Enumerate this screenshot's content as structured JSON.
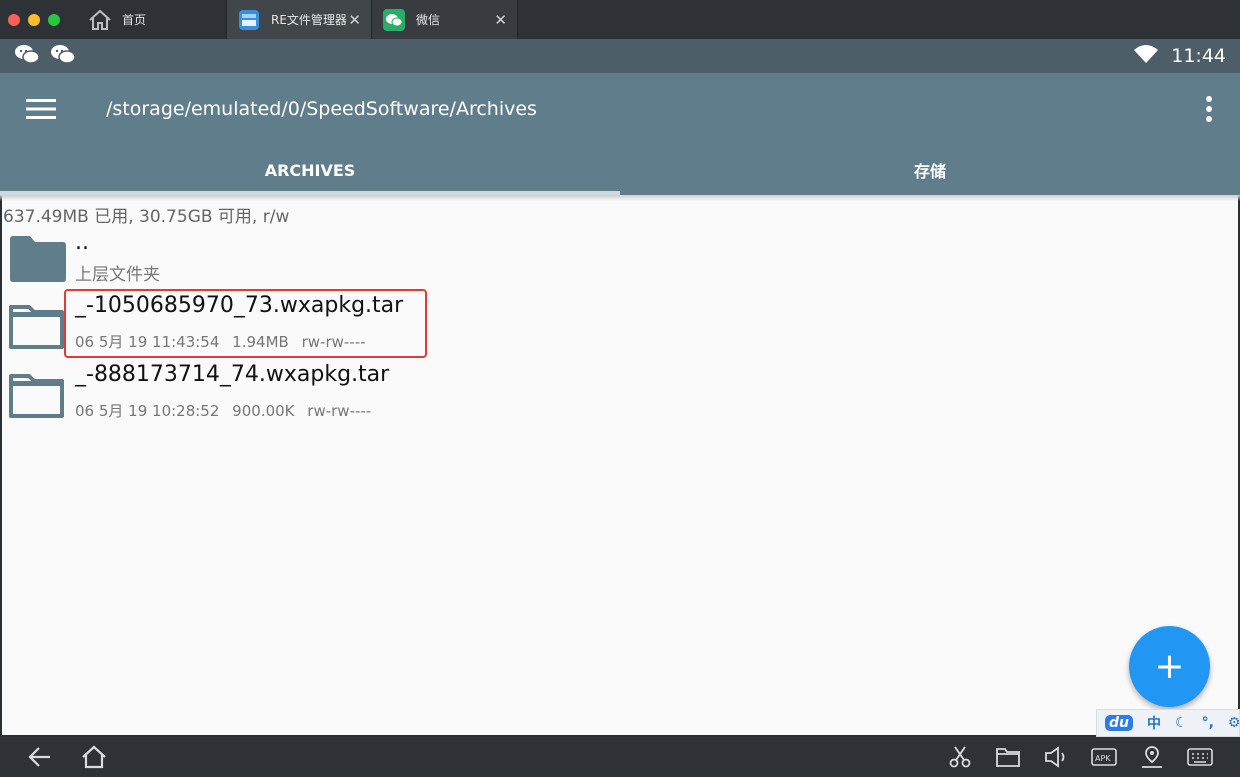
{
  "window_tabs": [
    {
      "label": "首页"
    },
    {
      "label": "RE文件管理器"
    },
    {
      "label": "微信"
    }
  ],
  "status_bar": {
    "time": "11:44"
  },
  "toolbar": {
    "path": "/storage/emulated/0/SpeedSoftware/Archives"
  },
  "tabs": [
    {
      "label": "ARCHIVES"
    },
    {
      "label": "存储"
    }
  ],
  "usage": "637.49MB 已用, 30.75GB 可用, r/w",
  "files": [
    {
      "name": "..",
      "subtitle": "上层文件夹"
    },
    {
      "name": "_-1050685970_73.wxapkg.tar",
      "date": "06 5月 19 11:43:54",
      "size": "1.94MB",
      "perm": "rw-rw----"
    },
    {
      "name": "_-888173714_74.wxapkg.tar",
      "date": "06 5月 19 10:28:52",
      "size": "900.00K",
      "perm": "rw-rw----"
    }
  ],
  "fab": {
    "label": "+"
  },
  "ime": {
    "logo": "du",
    "mode": "中",
    "punct": "°,"
  },
  "colors": {
    "primary": "#607d8b",
    "accent": "#2196f3",
    "highlight": "#e53935"
  }
}
